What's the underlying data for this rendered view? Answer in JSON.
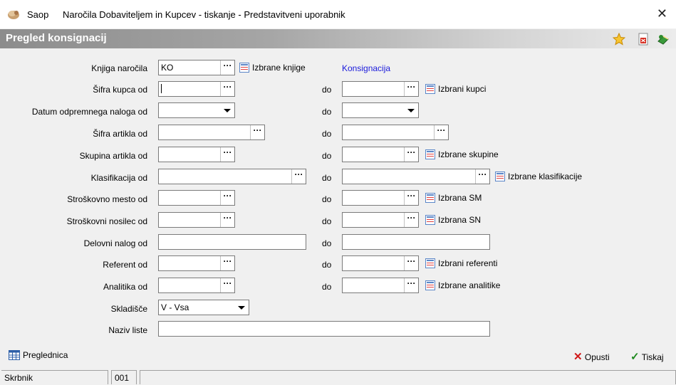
{
  "window": {
    "app_name": "Saop",
    "title": "Naročila Dobaviteljem in Kupcev - tiskanje - Predstavitveni uporabnik"
  },
  "header": {
    "title": "Pregled konsignacij"
  },
  "form": {
    "knjiga": {
      "label": "Knjiga naročila",
      "value": "KO",
      "select_link": "Izbrane knjige",
      "info": "Konsignacija"
    },
    "sifra_kupca": {
      "label": "Šifra kupca od",
      "select_link": "Izbrani kupci"
    },
    "datum": {
      "label": "Datum odpremnega naloga od"
    },
    "sifra_artikla": {
      "label": "Šifra artikla od"
    },
    "skupina": {
      "label": "Skupina artikla od",
      "select_link": "Izbrane skupine"
    },
    "klasifikacija": {
      "label": "Klasifikacija od",
      "select_link": "Izbrane klasifikacije"
    },
    "sm": {
      "label": "Stroškovno mesto od",
      "select_link": "Izbrana SM"
    },
    "sn": {
      "label": "Stroškovni  nosilec od",
      "select_link": "Izbrana SN"
    },
    "delovni": {
      "label": "Delovni nalog od"
    },
    "referent": {
      "label": "Referent od",
      "select_link": "Izbrani referenti"
    },
    "analitika": {
      "label": "Analitika od",
      "select_link": "Izbrane analitike"
    },
    "skladisce": {
      "label": "Skladišče",
      "value": "V - Vsa"
    },
    "naziv": {
      "label": "Naziv liste",
      "value": ""
    },
    "do_label": "do"
  },
  "buttons": {
    "preglednica": "Preglednica",
    "opusti": "Opusti",
    "tiskaj": "Tiskaj"
  },
  "status": {
    "user": "Skrbnik",
    "code": "001"
  }
}
